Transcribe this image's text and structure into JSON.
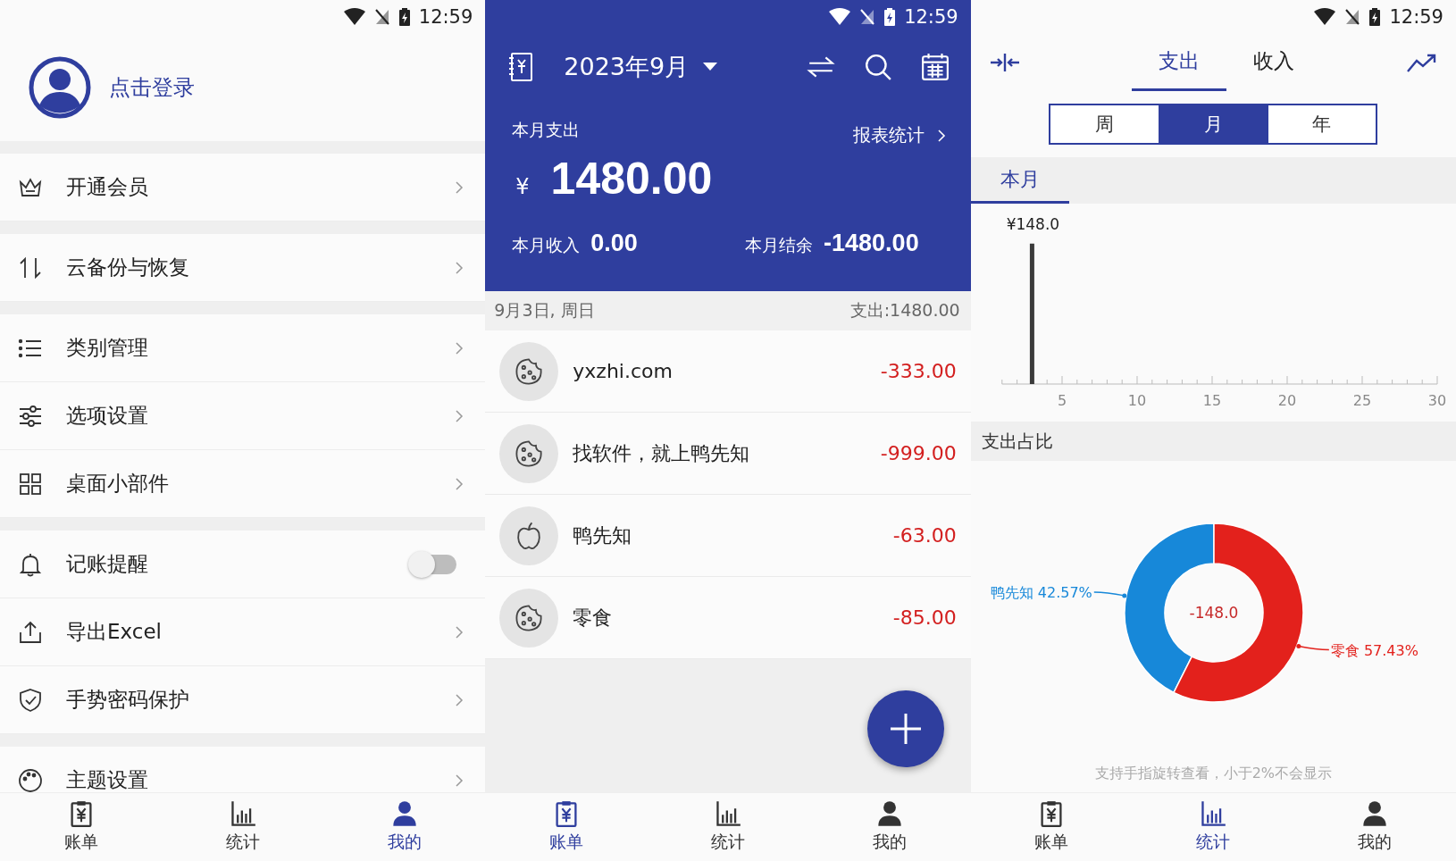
{
  "screens": [
    {
      "status_bar": {
        "time": "12:59"
      },
      "profile": {
        "login": "点击登录"
      },
      "menu_groups": [
        [
          {
            "kind": "link",
            "label": "开通会员"
          }
        ],
        [
          {
            "kind": "link",
            "label": "云备份与恢复"
          }
        ],
        [
          {
            "kind": "link",
            "label": "类别管理"
          },
          {
            "kind": "link",
            "label": "选项设置"
          },
          {
            "kind": "link",
            "label": "桌面小部件"
          }
        ],
        [
          {
            "kind": "toggle",
            "label": "记账提醒",
            "on": false
          },
          {
            "kind": "link",
            "label": "导出Excel"
          },
          {
            "kind": "link",
            "label": "手势密码保护"
          }
        ],
        [
          {
            "kind": "link",
            "label": "主题设置"
          }
        ]
      ],
      "nav": [
        {
          "label": "账单",
          "selected": false
        },
        {
          "label": "统计",
          "selected": false
        },
        {
          "label": "我的",
          "selected": true
        }
      ]
    },
    {
      "status_bar": {
        "time": "12:59"
      },
      "header": {
        "month": "2023年9月",
        "expense_label": "本月支出",
        "report_link": "报表统计",
        "currency": "¥",
        "expense": "1480.00",
        "income_label": "本月收入",
        "income": "0.00",
        "balance_label": "本月结余",
        "balance": "-1480.00"
      },
      "day": {
        "date": "9月3日, 周日",
        "total": "支出:1480.00"
      },
      "transactions": [
        {
          "name": "yxzhi.com",
          "amount": "-333.00"
        },
        {
          "name": "找软件，就上鸭先知",
          "amount": "-999.00"
        },
        {
          "name": "鸭先知",
          "amount": "-63.00"
        },
        {
          "name": "零食",
          "amount": "-85.00"
        }
      ],
      "nav": [
        {
          "label": "账单",
          "selected": true
        },
        {
          "label": "统计",
          "selected": false
        },
        {
          "label": "我的",
          "selected": false
        }
      ]
    },
    {
      "status_bar": {
        "time": "12:59"
      },
      "type_tabs": [
        {
          "label": "支出",
          "selected": true
        },
        {
          "label": "收入",
          "selected": false
        }
      ],
      "periods": [
        {
          "label": "周",
          "selected": false
        },
        {
          "label": "月",
          "selected": true
        },
        {
          "label": "年",
          "selected": false
        }
      ],
      "range_tab": {
        "label": "本月",
        "selected": true
      },
      "trend_chart": {
        "chart_data": {
          "type": "bar",
          "x": [
            3
          ],
          "values": [
            148
          ],
          "xlim": [
            1,
            30
          ],
          "xticks": [
            5,
            10,
            15,
            20,
            25,
            30
          ],
          "value_labels": [
            "¥148.0"
          ]
        }
      },
      "share_chart": {
        "chart_data": {
          "type": "donut",
          "title": "支出占比",
          "categories": [
            "鸭先知 42.57%",
            "零食 57.43%"
          ],
          "values": [
            42.57,
            57.43
          ],
          "annotations": [
            "-148.0"
          ]
        }
      },
      "hint": "支持手指旋转查看，小于2%不会显示",
      "nav": [
        {
          "label": "账单",
          "selected": false
        },
        {
          "label": "统计",
          "selected": true
        },
        {
          "label": "我的",
          "selected": false
        }
      ]
    }
  ]
}
